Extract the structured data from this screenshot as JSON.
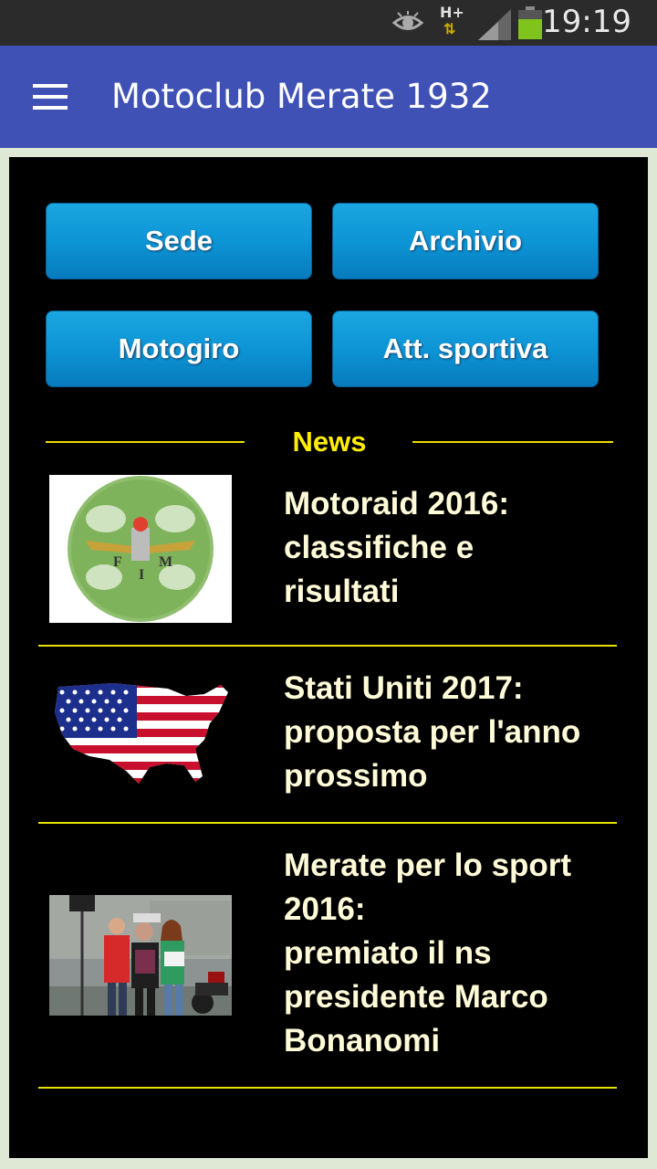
{
  "status_bar": {
    "time": "19:19",
    "network_label": "H+"
  },
  "app_bar": {
    "title": "Motoclub Merate 1932",
    "menu_icon": "hamburger-menu-icon"
  },
  "nav_buttons": [
    {
      "label": "Sede"
    },
    {
      "label": "Archivio"
    },
    {
      "label": "Motogiro"
    },
    {
      "label": "Att. sportiva"
    }
  ],
  "news": {
    "header": "News",
    "items": [
      {
        "title": "Motoraid 2016:\nclassifiche e\nrisultati",
        "thumb": "fmi-logo-image"
      },
      {
        "title": "Stati Uniti 2017:\nproposta per l'anno\nprossimo",
        "thumb": "usa-flag-map-image"
      },
      {
        "title": "Merate per lo sport\n2016:\npremiato il ns\npresidente Marco\nBonanomi",
        "thumb": "award-photo-image"
      }
    ]
  },
  "colors": {
    "app_bar": "#3f51b5",
    "accent_yellow": "#ffee00",
    "button_blue": "#0d95d6",
    "battery_green": "#7fc31c"
  },
  "battery_level": 0.7
}
